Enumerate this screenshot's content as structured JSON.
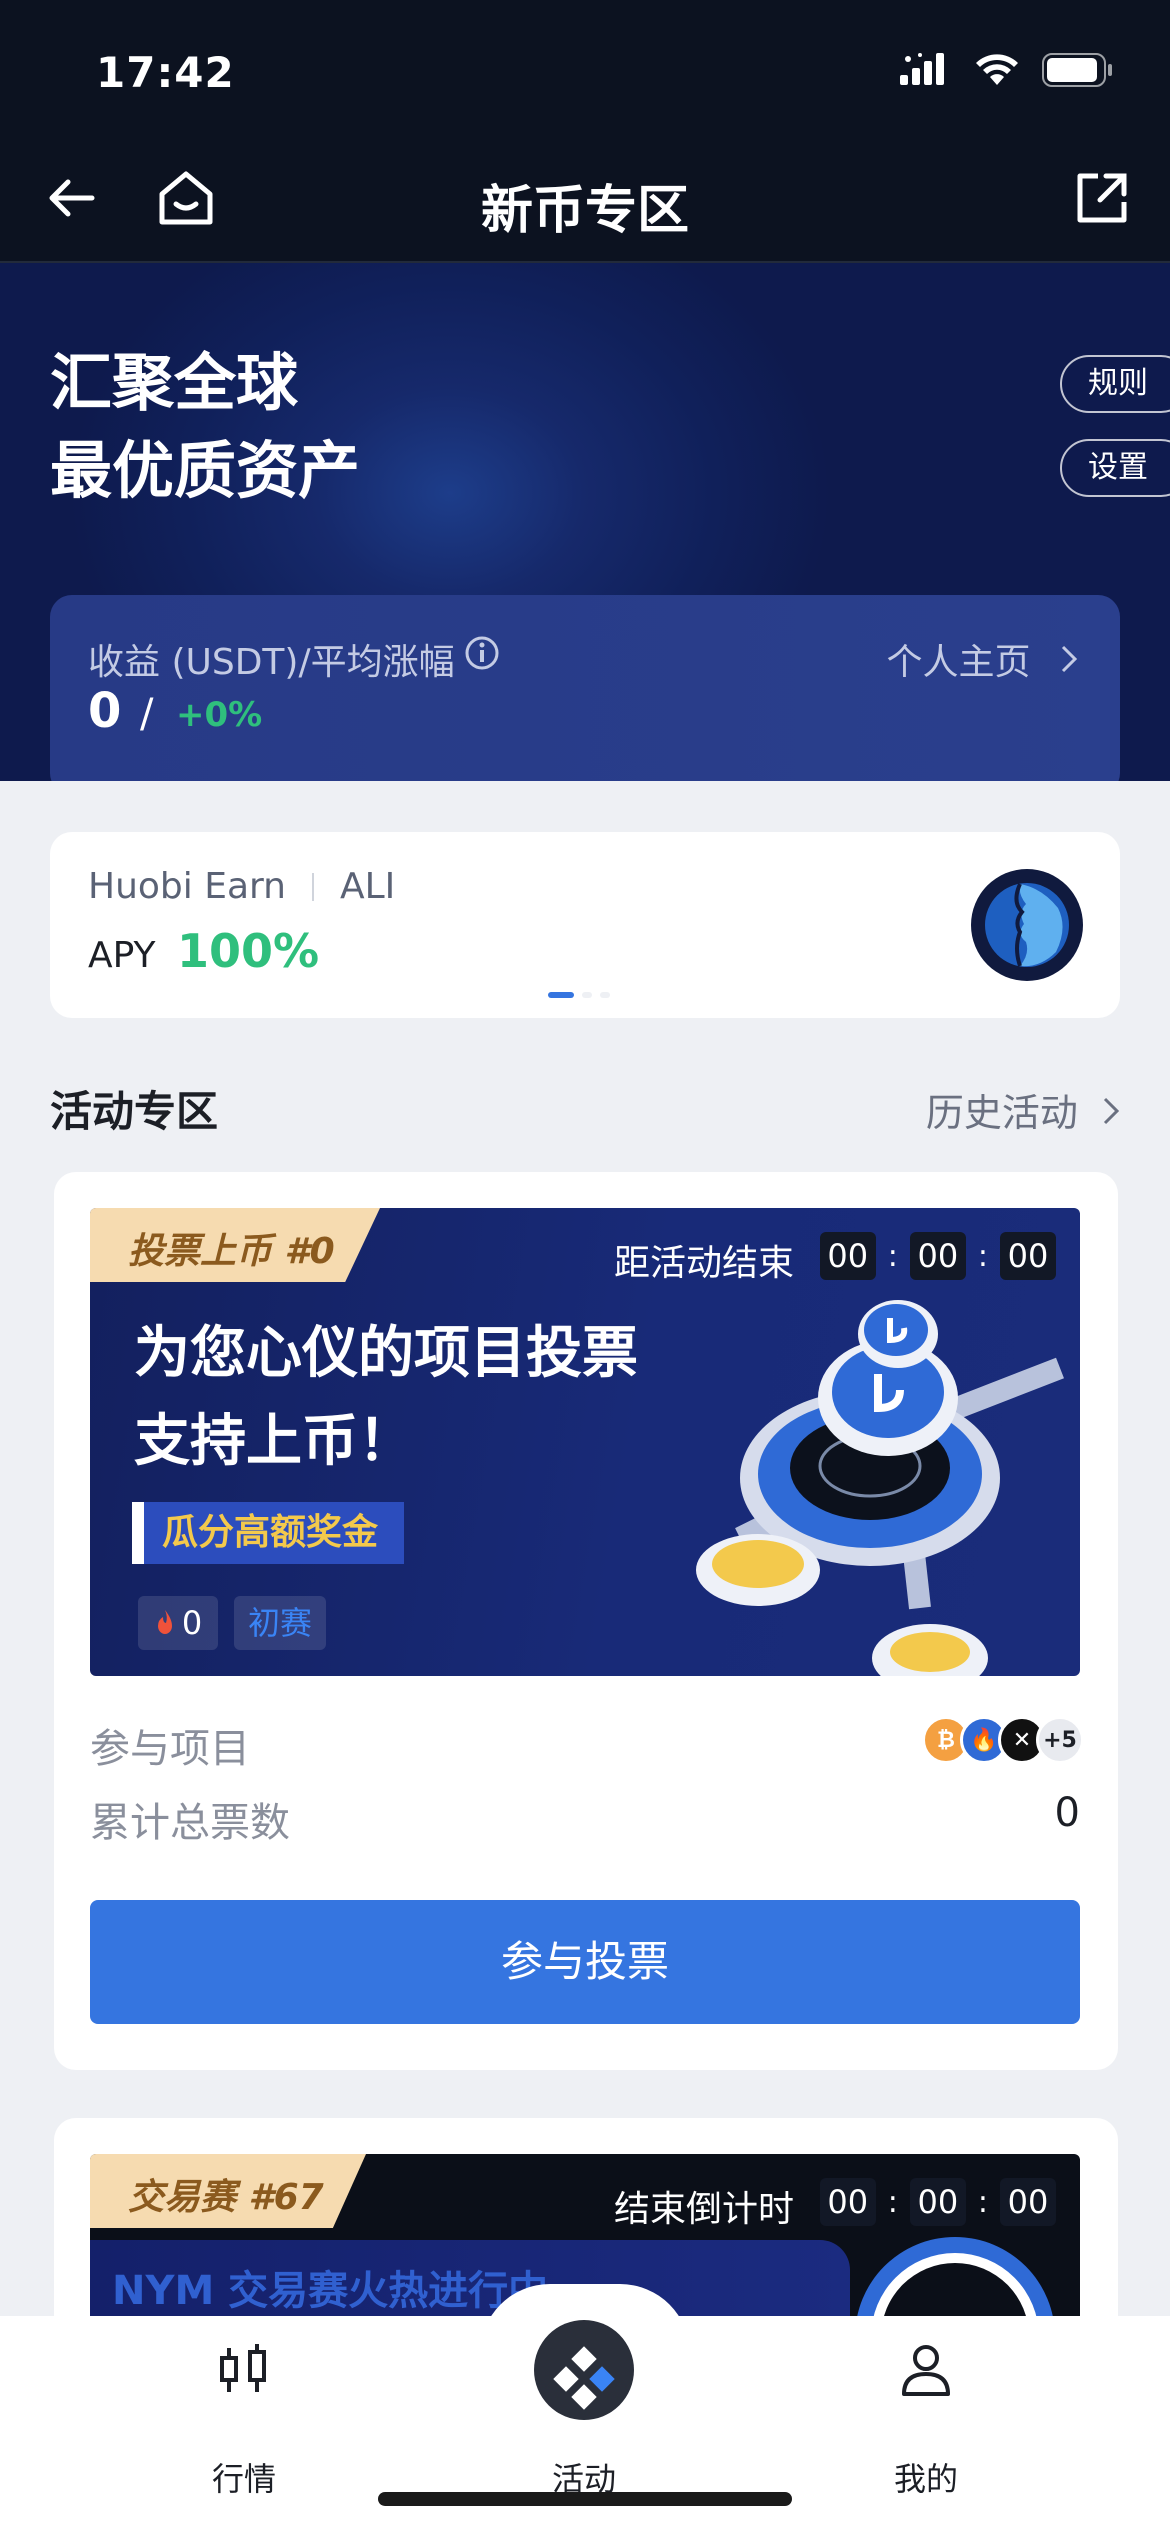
{
  "status_bar": {
    "time": "17:42"
  },
  "nav": {
    "title": "新币专区",
    "back_icon": "arrow-left-icon",
    "home_icon": "home-icon",
    "share_icon": "share-icon"
  },
  "hero": {
    "title_line1": "汇聚全球",
    "title_line2": "最优质资产",
    "rules_label": "规则",
    "settings_label": "设置",
    "earnings_label": "收益 (USDT)/平均涨幅",
    "earnings_value": "0",
    "separator": "/",
    "avg_change": "+0%",
    "profile_link": "个人主页"
  },
  "earn_banner": {
    "brand": "Huobi Earn",
    "asset": "ALI",
    "apy_label": "APY",
    "apy_value": "100%",
    "pages": 3,
    "active_page": 0
  },
  "section": {
    "title": "活动专区",
    "history_link": "历史活动"
  },
  "activity_1": {
    "tag": "投票上币 #0",
    "countdown_label": "距活动结束",
    "countdown": [
      "00",
      "00",
      "00"
    ],
    "headline_line1": "为您心仪的项目投票",
    "headline_line2": "支持上币！",
    "sub_banner": "瓜分高额奖金",
    "fire_count": "0",
    "stage": "初赛",
    "participants_label": "参与项目",
    "extra_count": "+5",
    "total_votes_label": "累计总票数",
    "total_votes_value": "0",
    "vote_button": "参与投票"
  },
  "activity_2": {
    "tag": "交易赛 #67",
    "countdown_label": "结束倒计时",
    "countdown": [
      "00",
      "00",
      "00"
    ],
    "inner_text": "NYM 交易赛火热进行中"
  },
  "tabbar": {
    "tabs": [
      {
        "label": "行情",
        "icon": "candlestick-icon"
      },
      {
        "label": "活动",
        "icon": "activity-diamond-icon"
      },
      {
        "label": "我的",
        "icon": "user-icon"
      }
    ]
  },
  "colors": {
    "accent": "#3575e0",
    "positive": "#2fbf7d",
    "header_bg": "#0c1220",
    "hero_bg": "#10205a"
  }
}
